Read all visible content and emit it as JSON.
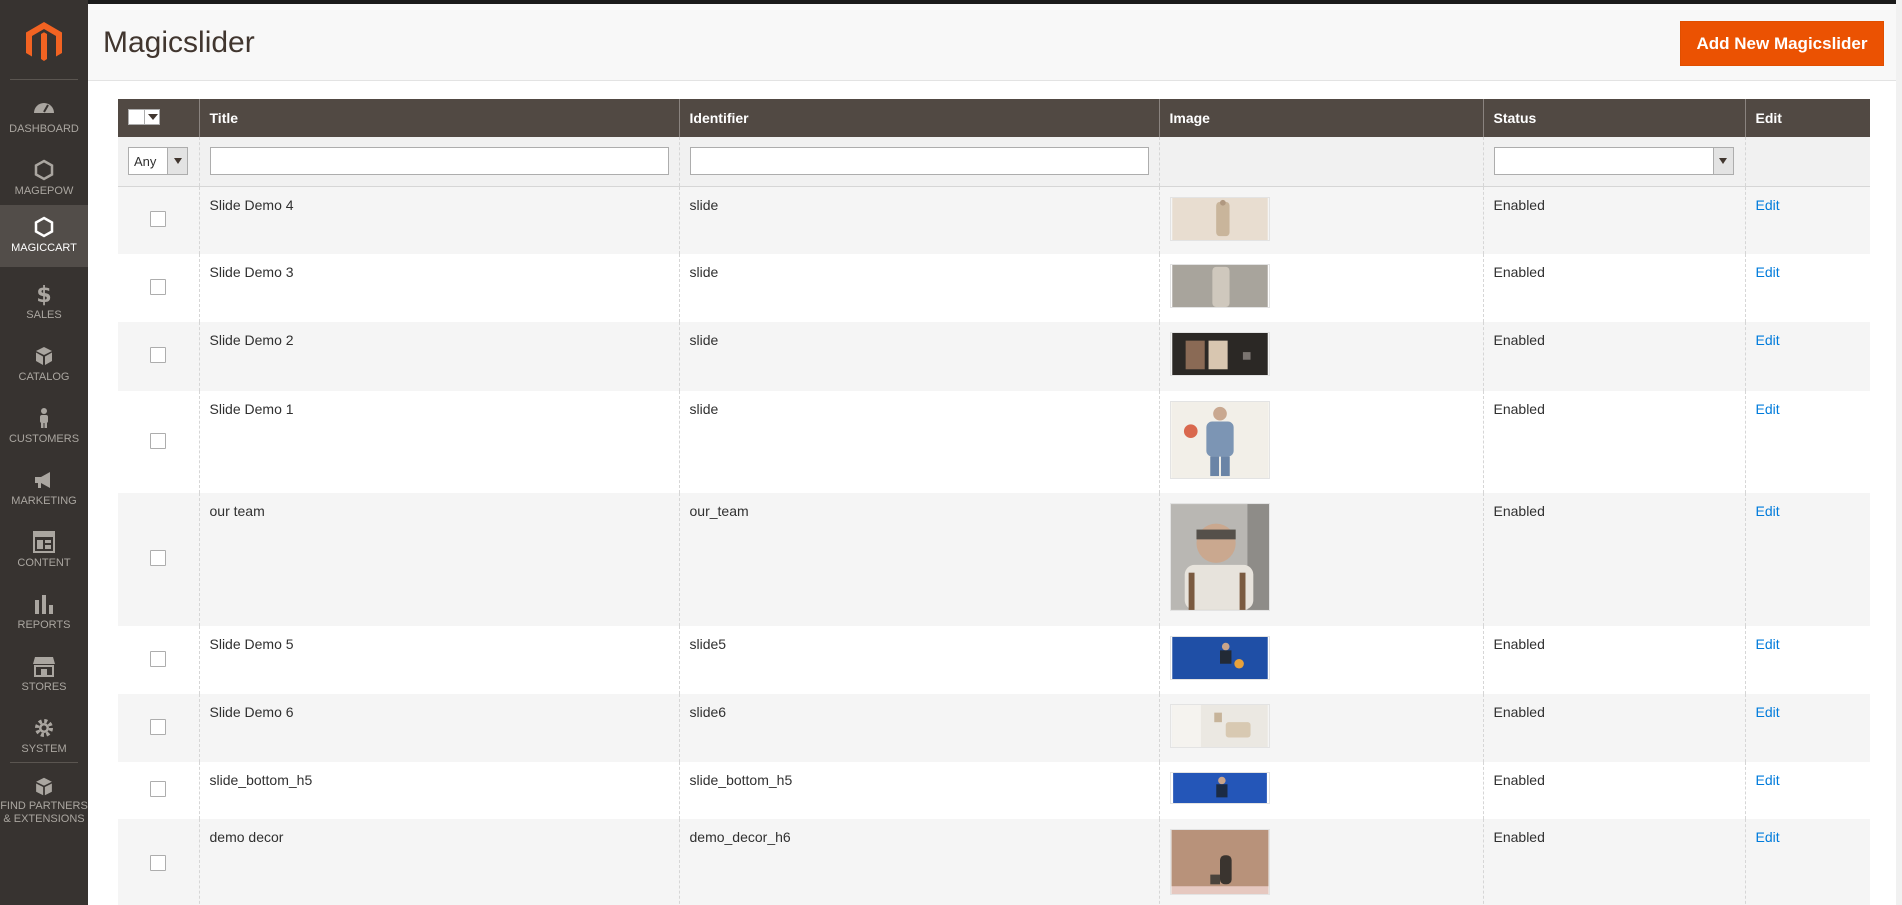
{
  "sidebar": {
    "items": [
      {
        "label": "DASHBOARD",
        "icon": "dashboard-icon"
      },
      {
        "label": "MAGEPOW",
        "icon": "hexagon-icon"
      },
      {
        "label": "MAGICCART",
        "icon": "hexagon-icon",
        "active": true
      },
      {
        "label": "SALES",
        "icon": "dollar-icon"
      },
      {
        "label": "CATALOG",
        "icon": "cube-icon"
      },
      {
        "label": "CUSTOMERS",
        "icon": "person-icon"
      },
      {
        "label": "MARKETING",
        "icon": "megaphone-icon"
      },
      {
        "label": "CONTENT",
        "icon": "layout-icon"
      },
      {
        "label": "REPORTS",
        "icon": "bar-chart-icon"
      },
      {
        "label": "STORES",
        "icon": "storefront-icon"
      },
      {
        "label": "SYSTEM",
        "icon": "gear-icon"
      },
      {
        "label_line1": "FIND PARTNERS",
        "label_line2": "& EXTENSIONS",
        "icon": "blocks-icon"
      }
    ]
  },
  "header": {
    "title": "Magicslider",
    "add_button": "Add New Magicslider"
  },
  "grid": {
    "columns": [
      "Title",
      "Identifier",
      "Image",
      "Status",
      "Edit"
    ],
    "filters": {
      "mass_select": "Any"
    },
    "rows": [
      {
        "title": "Slide Demo 4",
        "identifier": "slide",
        "status": "Enabled",
        "edit": "Edit"
      },
      {
        "title": "Slide Demo 3",
        "identifier": "slide",
        "status": "Enabled",
        "edit": "Edit"
      },
      {
        "title": "Slide Demo 2",
        "identifier": "slide",
        "status": "Enabled",
        "edit": "Edit"
      },
      {
        "title": "Slide Demo 1",
        "identifier": "slide",
        "status": "Enabled",
        "edit": "Edit"
      },
      {
        "title": "our team",
        "identifier": "our_team",
        "status": "Enabled",
        "edit": "Edit"
      },
      {
        "title": "Slide Demo 5",
        "identifier": "slide5",
        "status": "Enabled",
        "edit": "Edit"
      },
      {
        "title": "Slide Demo 6",
        "identifier": "slide6",
        "status": "Enabled",
        "edit": "Edit"
      },
      {
        "title": "slide_bottom_h5",
        "identifier": "slide_bottom_h5",
        "status": "Enabled",
        "edit": "Edit"
      },
      {
        "title": "demo decor",
        "identifier": "demo_decor_h6",
        "status": "Enabled",
        "edit": "Edit"
      }
    ]
  },
  "colors": {
    "accent": "#eb5202",
    "sidebar": "#373330",
    "header_row": "#514943",
    "link": "#007bdb"
  }
}
